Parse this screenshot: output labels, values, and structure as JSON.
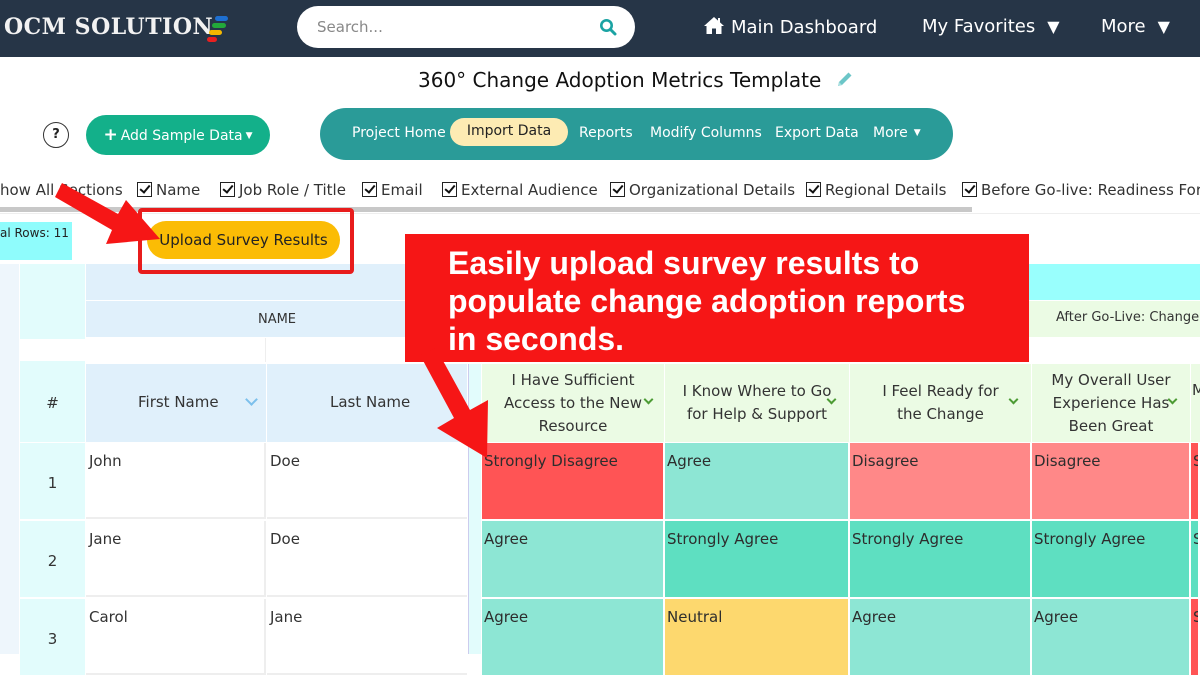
{
  "brand": {
    "name": "OCM SOLUTION",
    "logo_bar_colors": [
      "#1e6fd0",
      "#22a83a",
      "#f5b800",
      "#e82020"
    ]
  },
  "search": {
    "placeholder": "Search...",
    "icon": "search-icon"
  },
  "topnav": {
    "main_dashboard": "Main Dashboard",
    "main_dashboard_icon": "home-icon",
    "my_favorites": "My Favorites",
    "more": "More",
    "caret": "▼"
  },
  "page": {
    "title": "360° Change Adoption Metrics Template",
    "edit_icon": "pencil-icon"
  },
  "toolbar": {
    "help_label": "?",
    "add_sample_data": "Add Sample Data",
    "tabs": [
      {
        "label": "Project Home",
        "active": false
      },
      {
        "label": "Import Data",
        "active": true
      },
      {
        "label": "Reports",
        "active": false
      },
      {
        "label": "Modify Columns",
        "active": false
      },
      {
        "label": "Export Data",
        "active": false
      },
      {
        "label": "More",
        "active": false
      }
    ]
  },
  "sections": {
    "show_all": "how All Sections",
    "items": [
      {
        "label": "Name",
        "checked": true
      },
      {
        "label": "Job Role / Title",
        "checked": true
      },
      {
        "label": "Email",
        "checked": true
      },
      {
        "label": "External Audience",
        "checked": true
      },
      {
        "label": "Organizational Details",
        "checked": true
      },
      {
        "label": "Regional Details",
        "checked": true
      },
      {
        "label": "Before Go-live: Readiness For L",
        "checked": true
      }
    ]
  },
  "rows_info": "al Rows: 11",
  "upload_button": "Upload Survey Results",
  "callout": {
    "line1": "Easily upload survey results to",
    "line2": "populate change adoption reports",
    "line3": "in seconds."
  },
  "table": {
    "group_headers": {
      "name": "NAME",
      "after_go_live": "After Go-Live: Change A"
    },
    "columns": {
      "num": "#",
      "first_name": "First Name",
      "last_name": "Last Name",
      "q1": "I Have Sufficient Access to the New Resource",
      "q2": "I Know Where to Go for Help & Support",
      "q3": "I Feel Ready for the Change",
      "q4": "My Overall User Experience Has Been Great",
      "q5": "M"
    },
    "rows": [
      {
        "num": "1",
        "first": "John",
        "last": "Doe",
        "q1": "Strongly Disagree",
        "q2": "Agree",
        "q3": "Disagree",
        "q4": "Disagree",
        "q5": "S"
      },
      {
        "num": "2",
        "first": "Jane",
        "last": "Doe",
        "q1": "Agree",
        "q2": "Strongly Agree",
        "q3": "Strongly Agree",
        "q4": "Strongly Agree",
        "q5": "S"
      },
      {
        "num": "3",
        "first": "Carol",
        "last": "Jane",
        "q1": "Agree",
        "q2": "Neutral",
        "q3": "Agree",
        "q4": "Agree",
        "q5": "S"
      }
    ],
    "response_colors": {
      "Strongly Disagree": "#ff5455",
      "Disagree": "#ff8888",
      "Neutral": "#fdd86e",
      "Agree": "#8de6d4",
      "Strongly Agree": "#5edfc1"
    }
  }
}
